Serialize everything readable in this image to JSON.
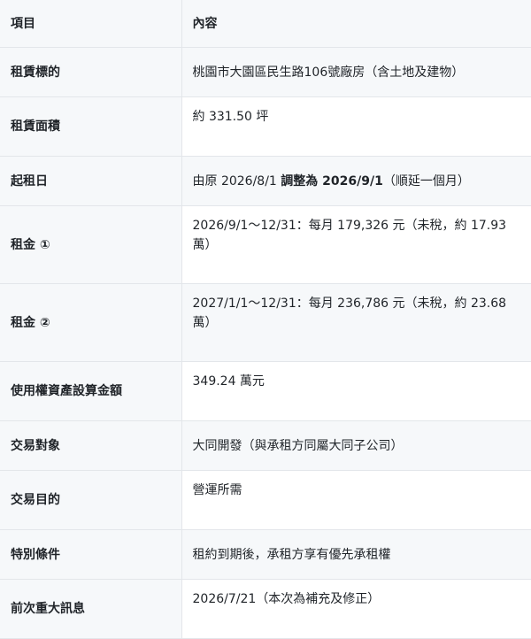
{
  "header": {
    "col1": "項目",
    "col2": "內容"
  },
  "rows": [
    {
      "key": "租賃標的",
      "value": "桃園市大園區民生路106號廠房（含土地及建物）"
    },
    {
      "key": "租賃面積",
      "value": "約 331.50 坪"
    },
    {
      "key": "起租日",
      "value_pre": "由原 2026/8/1 ",
      "value_bold": "調整為 2026/9/1",
      "value_post": "（順延一個月）"
    },
    {
      "key": "租金 ①",
      "value": "2026/9/1～12/31：每月 179,326 元（未稅，約 17.93 萬）"
    },
    {
      "key": "租金 ②",
      "value": "2027/1/1～12/31：每月 236,786 元（未稅，約 23.68 萬）"
    },
    {
      "key": "使用權資產設算金額",
      "value": "349.24 萬元"
    },
    {
      "key": "交易對象",
      "value": "大同開發（與承租方同屬大同子公司）"
    },
    {
      "key": "交易目的",
      "value": "營運所需"
    },
    {
      "key": "特別條件",
      "value": "租約到期後，承租方享有優先承租權"
    },
    {
      "key": "前次重大訊息",
      "value": "2026/7/21（本次為補充及修正）"
    }
  ]
}
